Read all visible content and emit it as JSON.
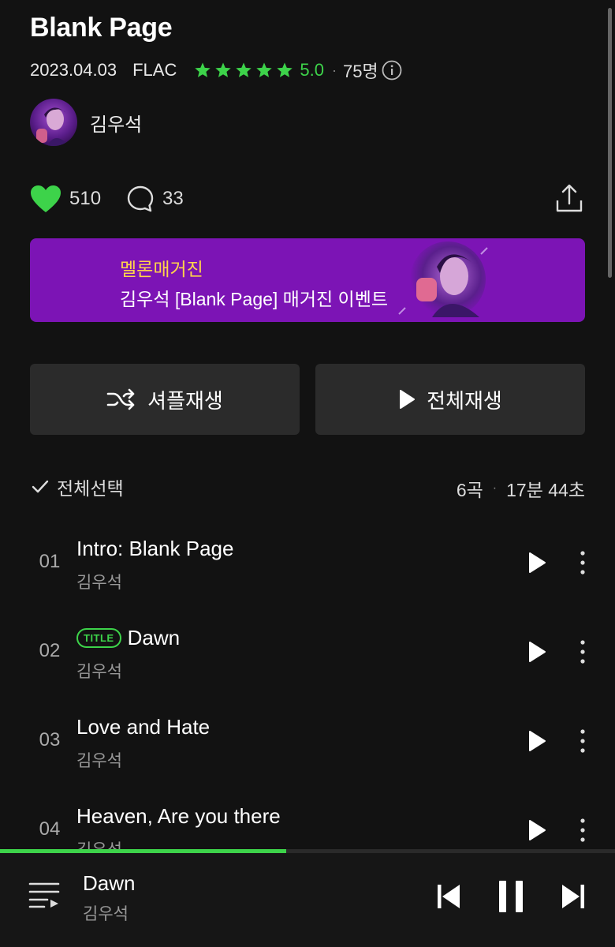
{
  "album": {
    "title": "Blank Page",
    "date": "2023.04.03",
    "format": "FLAC",
    "rating": "5.0",
    "rating_separator": "·",
    "rating_count": "75명",
    "star_count": 5
  },
  "artist": {
    "name": "김우석"
  },
  "actions": {
    "likes": "510",
    "comments": "33"
  },
  "banner": {
    "line1": "멜론매거진",
    "line2": "김우석 [Blank Page] 매거진 이벤트"
  },
  "buttons": {
    "shuffle": "셔플재생",
    "play_all": "전체재생"
  },
  "track_list": {
    "select_all": "전체선택",
    "count": "6곡",
    "separator": "·",
    "duration": "17분 44초"
  },
  "tracks": [
    {
      "num": "01",
      "title": "Intro: Blank Page",
      "artist": "김우석",
      "badge": ""
    },
    {
      "num": "02",
      "title": "Dawn",
      "artist": "김우석",
      "badge": "TITLE"
    },
    {
      "num": "03",
      "title": "Love and Hate",
      "artist": "김우석",
      "badge": ""
    },
    {
      "num": "04",
      "title": "Heaven, Are you there",
      "artist": "김우석",
      "badge": ""
    }
  ],
  "player": {
    "title": "Dawn",
    "artist": "김우석",
    "progress": 0.465
  },
  "colors": {
    "accent": "#3dd34a",
    "background": "#121212",
    "banner": "#7c14b5",
    "banner_highlight": "#ffd44a",
    "button": "#2b2b2b"
  }
}
